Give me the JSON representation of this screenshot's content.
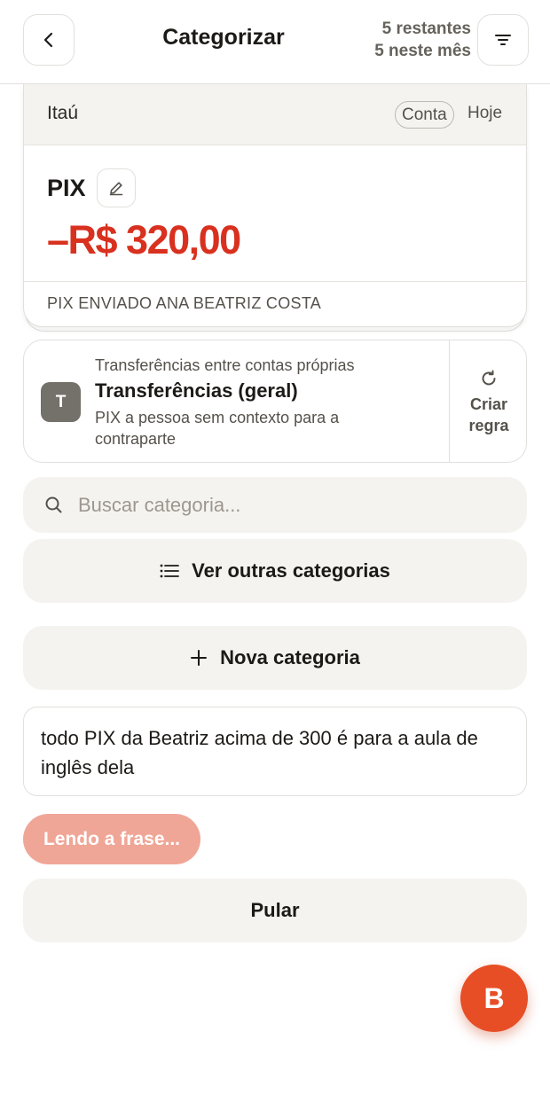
{
  "header": {
    "title": "Categorizar",
    "remaining": "5 restantes",
    "this_month": "5 neste mês",
    "back_icon": "chevron-left-icon",
    "filter_icon": "filter-icon"
  },
  "transaction": {
    "bank": "Itaú",
    "account_label": "Conta",
    "date": "Hoje",
    "name": "PIX",
    "amount": "–R$ 320,00",
    "description": "PIX ENVIADO ANA BEATRIZ COSTA",
    "amount_color": "#d9311f"
  },
  "suggestion": {
    "avatar_letter": "T",
    "group": "Transferências entre contas próprias",
    "category": "Transferências (geral)",
    "reason": "PIX a pessoa sem contexto para a contraparte",
    "rule_label": "Criar regra",
    "rule_icon": "refresh-icon"
  },
  "search": {
    "placeholder": "Buscar categoria..."
  },
  "actions": {
    "see_more": "Ver outras categorias",
    "new_category": "Nova categoria",
    "reading": "Lendo a frase...",
    "skip": "Pular"
  },
  "rule_input": {
    "text": "todo PIX da Beatriz acima de 300 é para a aula de inglês dela"
  },
  "user": {
    "initial": "B",
    "accent_color": "#e74e26"
  }
}
